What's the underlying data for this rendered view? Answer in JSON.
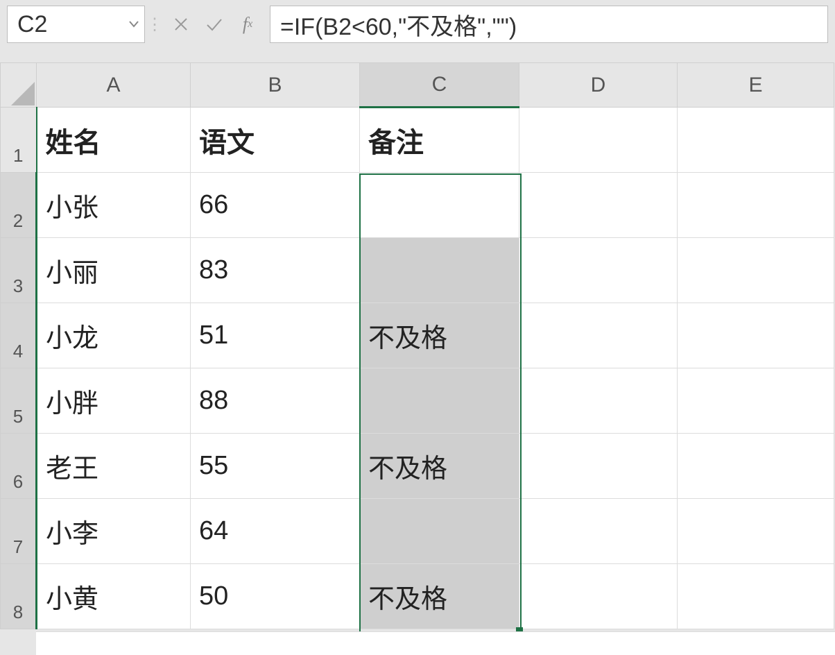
{
  "name_box": "C2",
  "formula": "=IF(B2<60,\"不及格\",\"\")",
  "columns": [
    "A",
    "B",
    "C",
    "D",
    "E"
  ],
  "row_numbers": [
    "1",
    "2",
    "3",
    "4",
    "5",
    "6",
    "7",
    "8"
  ],
  "headers": {
    "A": "姓名",
    "B": "语文",
    "C": "备注"
  },
  "rows": [
    {
      "A": "小张",
      "B": "66",
      "C": ""
    },
    {
      "A": "小丽",
      "B": "83",
      "C": ""
    },
    {
      "A": "小龙",
      "B": "51",
      "C": "不及格"
    },
    {
      "A": "小胖",
      "B": "88",
      "C": ""
    },
    {
      "A": "老王",
      "B": "55",
      "C": "不及格"
    },
    {
      "A": "小李",
      "B": "64",
      "C": ""
    },
    {
      "A": "小黄",
      "B": "50",
      "C": "不及格"
    }
  ],
  "selection": {
    "active": "C2",
    "range": "C2:C8",
    "selected_col": "C"
  }
}
